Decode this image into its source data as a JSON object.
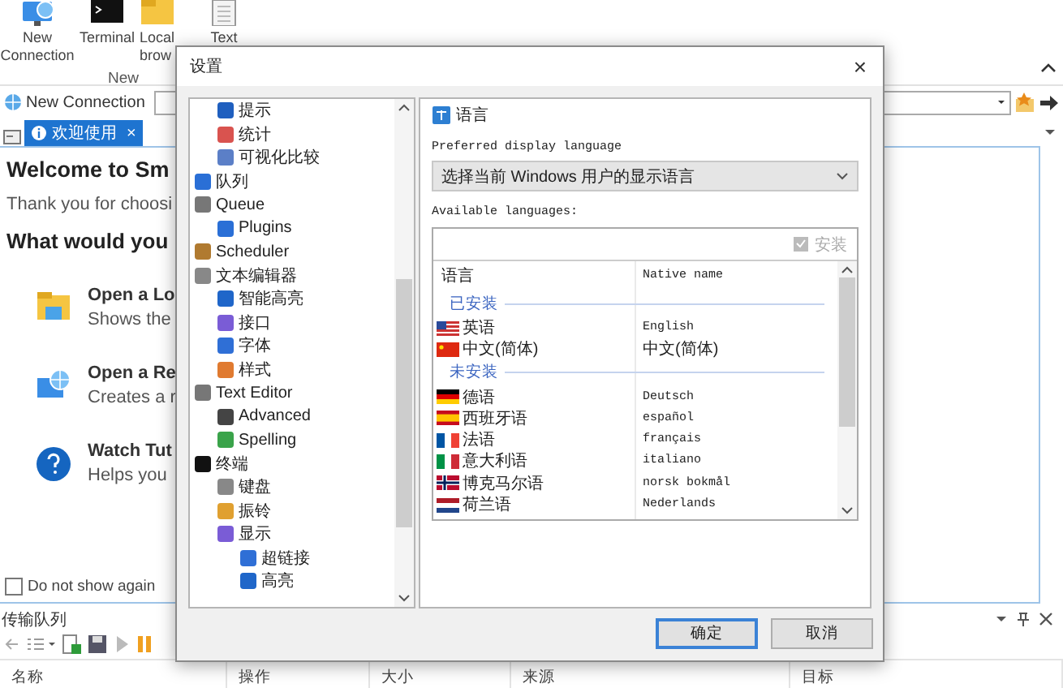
{
  "ribbon": {
    "buttons": [
      {
        "label": "New Connection"
      },
      {
        "label": "Terminal"
      },
      {
        "label": "Local brow"
      },
      {
        "label": "Text"
      }
    ],
    "group_label": "New"
  },
  "address_bar": {
    "label": "New Connection"
  },
  "tabs": [
    {
      "label": "欢迎使用",
      "close": "×",
      "selected": true
    }
  ],
  "welcome": {
    "title": "Welcome to Sm",
    "subtitle": "Thank you for choosi",
    "question": "What would you",
    "actions": [
      {
        "title": "Open a Lo",
        "description": "Shows the"
      },
      {
        "title": "Open a Re",
        "description": "Creates a r"
      },
      {
        "title": "Watch Tut",
        "description": "Helps you"
      }
    ],
    "dont_show_again": {
      "label": "Do not show again",
      "checked": false
    }
  },
  "transfer_queue": {
    "title": "传输队列",
    "columns": [
      "名称",
      "操作",
      "大小",
      "来源",
      "目标"
    ]
  },
  "dialog": {
    "title": "设置",
    "close": "×",
    "tree": [
      {
        "children": [
          {
            "label": "提示"
          },
          {
            "label": "统计"
          },
          {
            "label": "可视化比较"
          }
        ]
      },
      {
        "label": "队列"
      },
      {
        "label": "Queue",
        "children": [
          {
            "label": "Plugins"
          }
        ]
      },
      {
        "label": "Scheduler"
      },
      {
        "label": "文本编辑器",
        "children": [
          {
            "label": "智能高亮"
          },
          {
            "label": "接口"
          },
          {
            "label": "字体"
          },
          {
            "label": "样式"
          }
        ]
      },
      {
        "label": "Text Editor",
        "children": [
          {
            "label": "Advanced"
          },
          {
            "label": "Spelling"
          }
        ]
      },
      {
        "label": "终端",
        "children": [
          {
            "label": "键盘"
          },
          {
            "label": "振铃"
          },
          {
            "label": "显示",
            "children": [
              {
                "label": "超链接"
              },
              {
                "label": "高亮"
              }
            ]
          }
        ]
      }
    ],
    "language": {
      "title": "语言",
      "preferred_label": "Preferred display language",
      "preferred_value": "选择当前 Windows 用户的显示语言",
      "available_label": "Available languages:",
      "install_button": {
        "label": "安装",
        "disabled": true
      },
      "columns": [
        "语言",
        "Native name"
      ],
      "groups": [
        {
          "label": "已安装",
          "languages": [
            {
              "name": "英语",
              "native": "English"
            },
            {
              "name": "中文(简体)",
              "native": "中文(简体)"
            }
          ]
        },
        {
          "label": "未安装",
          "languages": [
            {
              "name": "德语",
              "native": "Deutsch"
            },
            {
              "name": "西班牙语",
              "native": "español"
            },
            {
              "name": "法语",
              "native": "français"
            },
            {
              "name": "意大利语",
              "native": "italiano"
            },
            {
              "name": "博克马尔语",
              "native": "norsk bokmål"
            },
            {
              "name": "荷兰语",
              "native": "Nederlands"
            }
          ]
        }
      ]
    },
    "buttons": [
      {
        "label": "确定",
        "default": true
      },
      {
        "label": "取消",
        "default": false
      }
    ]
  }
}
